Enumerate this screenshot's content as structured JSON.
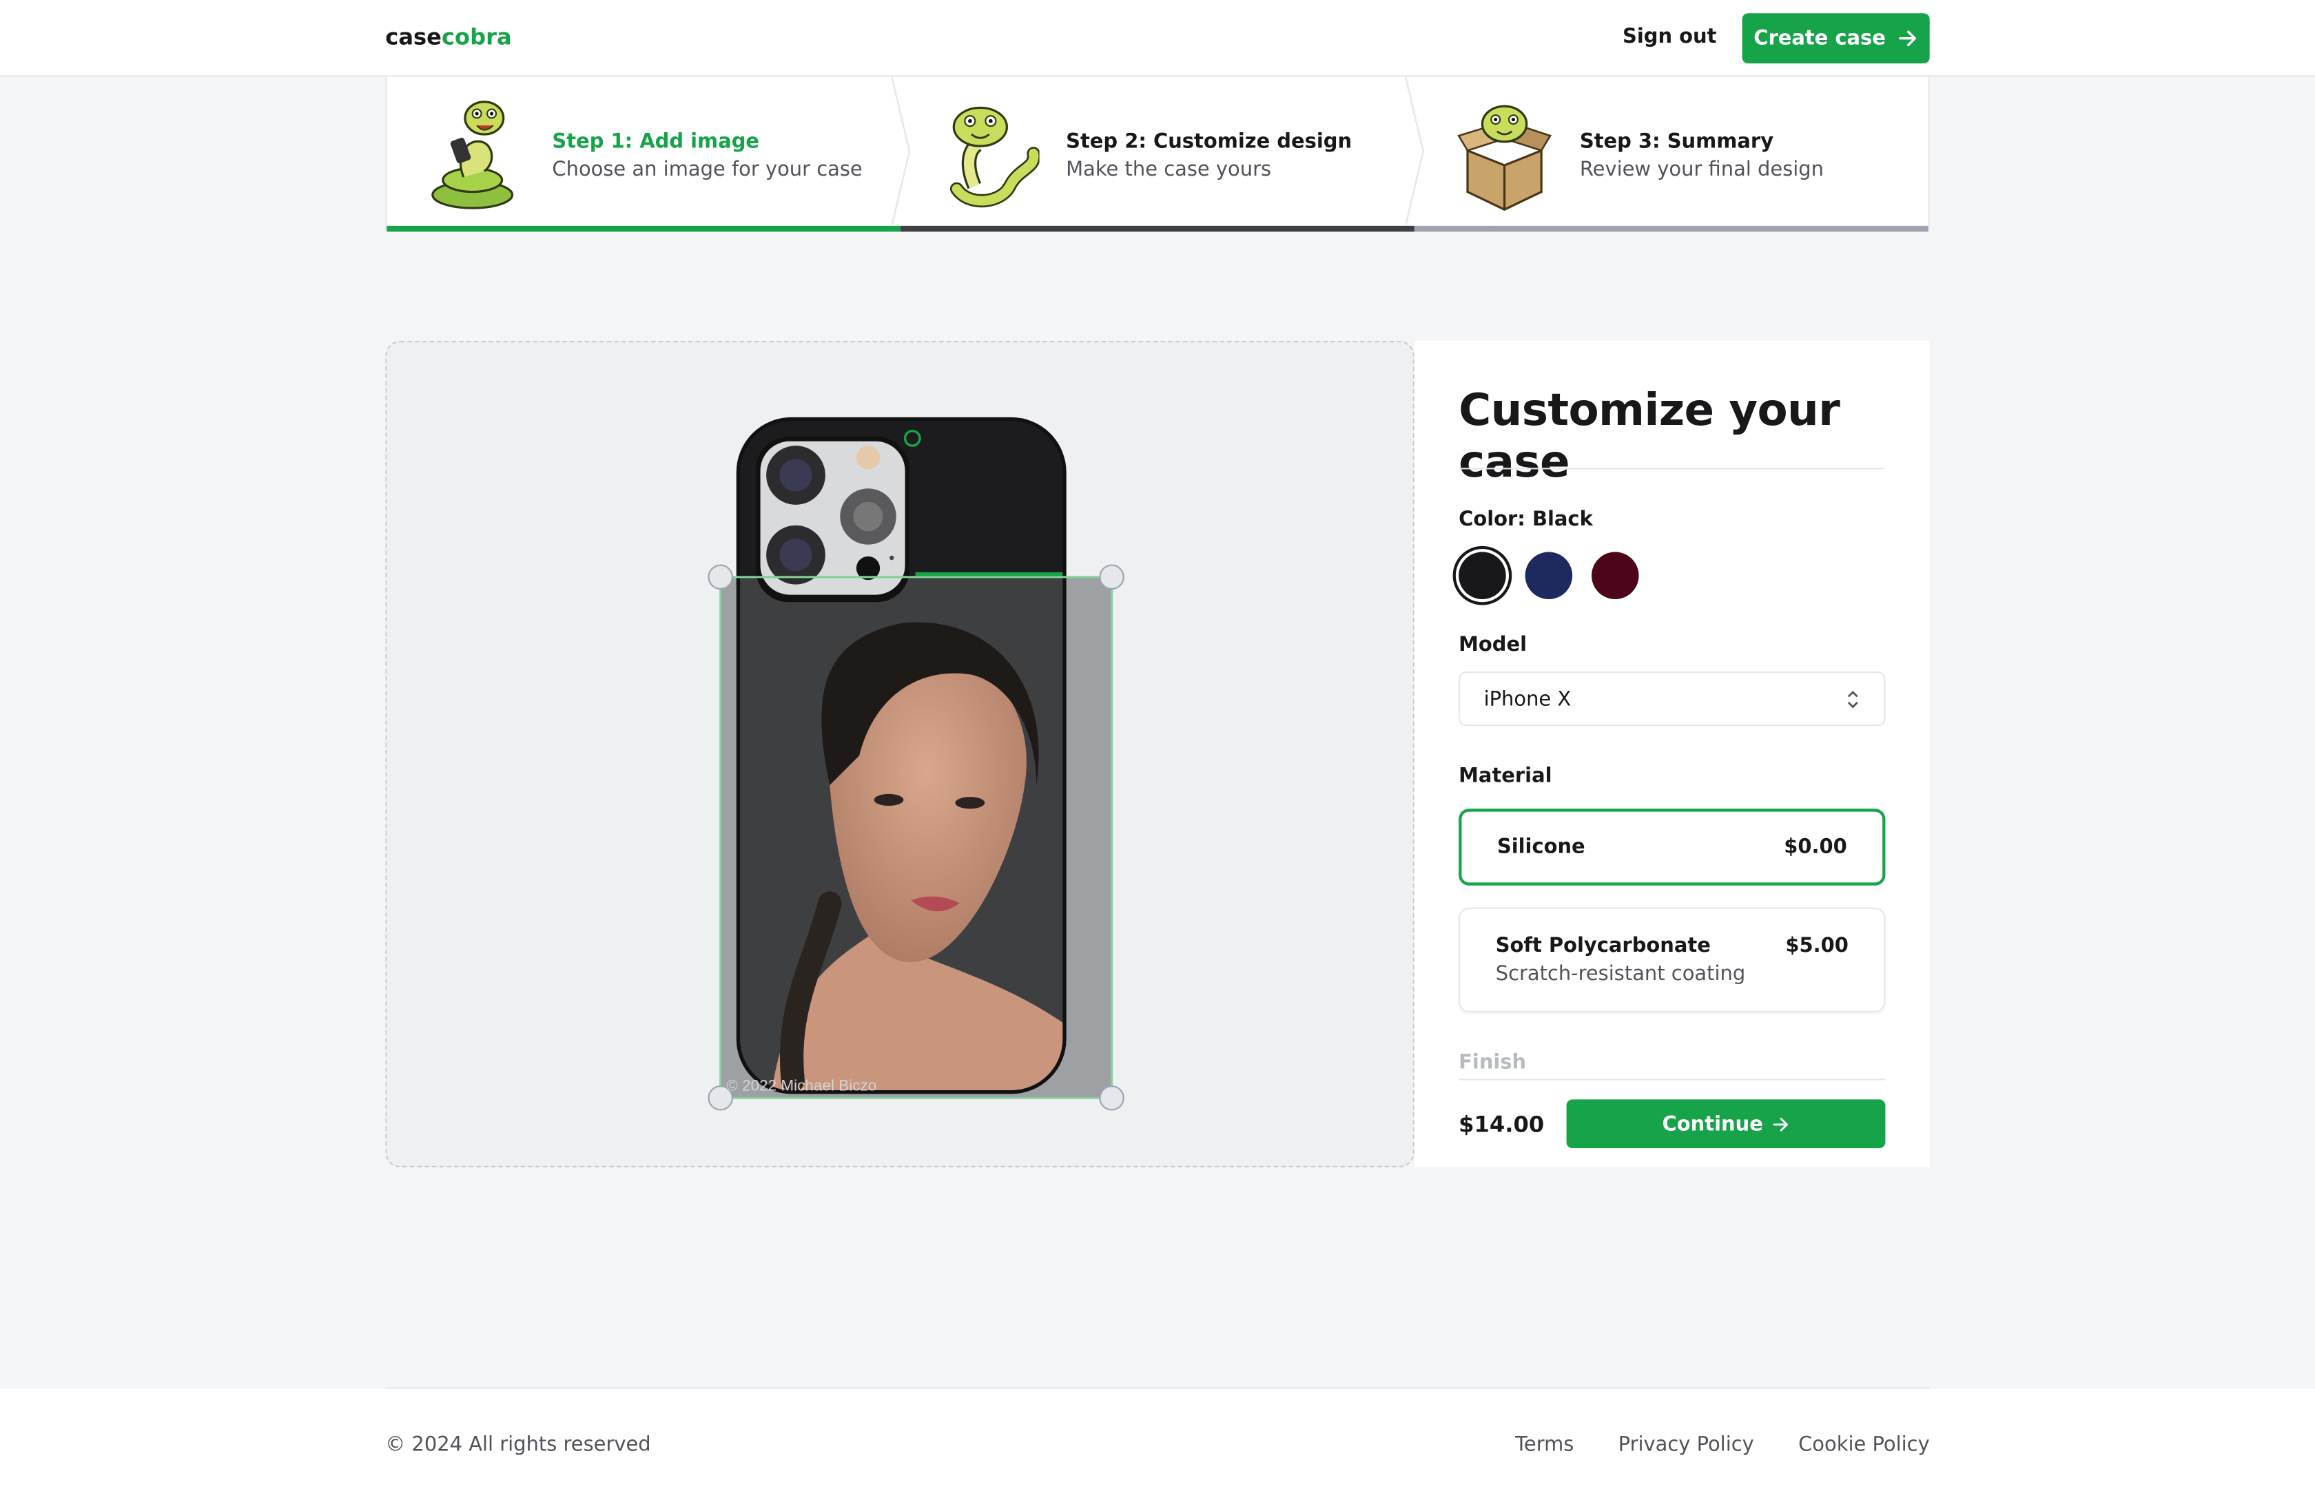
{
  "brand": {
    "part1": "case",
    "part2": "cobra",
    "accent": "#16a34a"
  },
  "nav": {
    "sign_out": "Sign out",
    "create_case": "Create case"
  },
  "steps": [
    {
      "title": "Step 1: Add image",
      "desc": "Choose an image for your case",
      "state": "complete"
    },
    {
      "title": "Step 2: Customize design",
      "desc": "Make the case yours",
      "state": "current"
    },
    {
      "title": "Step 3: Summary",
      "desc": "Review your final design",
      "state": "upcoming"
    }
  ],
  "editor": {
    "watermark": "© 2022 Michael Biczo"
  },
  "panel": {
    "heading": "Customize your case",
    "color_label": "Color: Black",
    "colors": [
      {
        "name": "Black",
        "hex": "#18181b",
        "selected": true
      },
      {
        "name": "Blue",
        "hex": "#1e2a5e",
        "selected": false
      },
      {
        "name": "Rose",
        "hex": "#4c0519",
        "selected": false
      }
    ],
    "model_label": "Model",
    "model_value": "iPhone X",
    "material_label": "Material",
    "materials": [
      {
        "name": "Silicone",
        "price": "$0.00",
        "desc": "",
        "selected": true
      },
      {
        "name": "Soft Polycarbonate",
        "price": "$5.00",
        "desc": "Scratch-resistant coating",
        "selected": false
      }
    ],
    "finish_label": "Finish",
    "total": "$14.00",
    "continue": "Continue"
  },
  "footer": {
    "copyright": "© 2024 All rights reserved",
    "links": [
      "Terms",
      "Privacy Policy",
      "Cookie Policy"
    ]
  }
}
